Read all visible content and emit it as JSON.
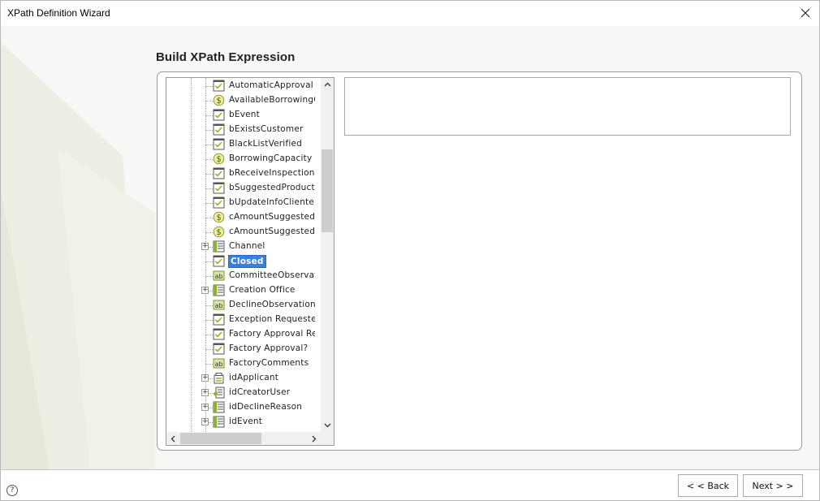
{
  "window": {
    "title": "XPath Definition Wizard"
  },
  "heading": "Build XPath Expression",
  "tree": {
    "items": [
      {
        "label": "AutomaticApproval",
        "icon": "checkbox-field-icon",
        "expandable": false,
        "selected": false
      },
      {
        "label": "AvailableBorrowingC",
        "icon": "currency-field-icon",
        "expandable": false,
        "selected": false
      },
      {
        "label": "bEvent",
        "icon": "checkbox-field-icon",
        "expandable": false,
        "selected": false
      },
      {
        "label": "bExistsCustomer",
        "icon": "checkbox-field-icon",
        "expandable": false,
        "selected": false
      },
      {
        "label": "BlackListVerified",
        "icon": "checkbox-field-icon",
        "expandable": false,
        "selected": false
      },
      {
        "label": "BorrowingCapacity",
        "icon": "currency-field-icon",
        "expandable": false,
        "selected": false
      },
      {
        "label": "bReceiveInspection",
        "icon": "checkbox-field-icon",
        "expandable": false,
        "selected": false
      },
      {
        "label": "bSuggestedProducts",
        "icon": "checkbox-field-icon",
        "expandable": false,
        "selected": false
      },
      {
        "label": "bUpdateInfoCliente",
        "icon": "checkbox-field-icon",
        "expandable": false,
        "selected": false
      },
      {
        "label": "cAmountSuggestedC",
        "icon": "currency-field-icon",
        "expandable": false,
        "selected": false
      },
      {
        "label": "cAmountSuggestedT",
        "icon": "currency-field-icon",
        "expandable": false,
        "selected": false
      },
      {
        "label": "Channel",
        "icon": "entity-icon",
        "expandable": true,
        "selected": false
      },
      {
        "label": "Closed",
        "icon": "checkbox-field-icon",
        "expandable": false,
        "selected": true
      },
      {
        "label": "CommitteeObservati",
        "icon": "text-field-icon",
        "expandable": false,
        "selected": false
      },
      {
        "label": "Creation Office",
        "icon": "entity-icon",
        "expandable": true,
        "selected": false
      },
      {
        "label": "DeclineObservations",
        "icon": "text-field-icon",
        "expandable": false,
        "selected": false
      },
      {
        "label": "Exception Requested",
        "icon": "checkbox-field-icon",
        "expandable": false,
        "selected": false
      },
      {
        "label": "Factory Approval Re",
        "icon": "checkbox-field-icon",
        "expandable": false,
        "selected": false
      },
      {
        "label": "Factory Approval?",
        "icon": "checkbox-field-icon",
        "expandable": false,
        "selected": false
      },
      {
        "label": "FactoryComments",
        "icon": "text-field-icon",
        "expandable": false,
        "selected": false
      },
      {
        "label": "idApplicant",
        "icon": "collection-icon",
        "expandable": true,
        "selected": false
      },
      {
        "label": "idCreatorUser",
        "icon": "user-entity-icon",
        "expandable": true,
        "selected": false
      },
      {
        "label": "idDeclineReason",
        "icon": "entity-icon",
        "expandable": true,
        "selected": false
      },
      {
        "label": "idEvent",
        "icon": "entity-icon",
        "expandable": true,
        "selected": false
      }
    ]
  },
  "expression": {
    "value": ""
  },
  "footer": {
    "help_label": "?",
    "back_label": "< < Back",
    "next_label": "Next > >"
  },
  "colors": {
    "selection": "#3c7fd8",
    "icon_green": "#8bb42a",
    "currency_yellow": "#d9d03a"
  }
}
